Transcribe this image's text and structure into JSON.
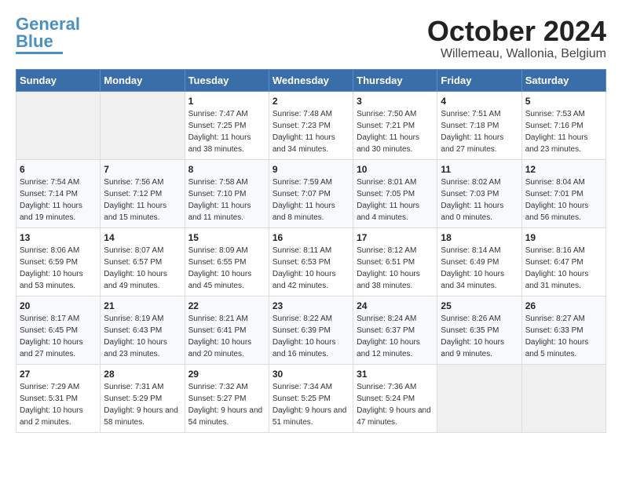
{
  "header": {
    "logo_general": "General",
    "logo_blue": "Blue",
    "month_title": "October 2024",
    "subtitle": "Willemeau, Wallonia, Belgium"
  },
  "days_of_week": [
    "Sunday",
    "Monday",
    "Tuesday",
    "Wednesday",
    "Thursday",
    "Friday",
    "Saturday"
  ],
  "weeks": [
    [
      {
        "day": "",
        "sunrise": "",
        "sunset": "",
        "daylight": ""
      },
      {
        "day": "",
        "sunrise": "",
        "sunset": "",
        "daylight": ""
      },
      {
        "day": "1",
        "sunrise": "Sunrise: 7:47 AM",
        "sunset": "Sunset: 7:25 PM",
        "daylight": "Daylight: 11 hours and 38 minutes."
      },
      {
        "day": "2",
        "sunrise": "Sunrise: 7:48 AM",
        "sunset": "Sunset: 7:23 PM",
        "daylight": "Daylight: 11 hours and 34 minutes."
      },
      {
        "day": "3",
        "sunrise": "Sunrise: 7:50 AM",
        "sunset": "Sunset: 7:21 PM",
        "daylight": "Daylight: 11 hours and 30 minutes."
      },
      {
        "day": "4",
        "sunrise": "Sunrise: 7:51 AM",
        "sunset": "Sunset: 7:18 PM",
        "daylight": "Daylight: 11 hours and 27 minutes."
      },
      {
        "day": "5",
        "sunrise": "Sunrise: 7:53 AM",
        "sunset": "Sunset: 7:16 PM",
        "daylight": "Daylight: 11 hours and 23 minutes."
      }
    ],
    [
      {
        "day": "6",
        "sunrise": "Sunrise: 7:54 AM",
        "sunset": "Sunset: 7:14 PM",
        "daylight": "Daylight: 11 hours and 19 minutes."
      },
      {
        "day": "7",
        "sunrise": "Sunrise: 7:56 AM",
        "sunset": "Sunset: 7:12 PM",
        "daylight": "Daylight: 11 hours and 15 minutes."
      },
      {
        "day": "8",
        "sunrise": "Sunrise: 7:58 AM",
        "sunset": "Sunset: 7:10 PM",
        "daylight": "Daylight: 11 hours and 11 minutes."
      },
      {
        "day": "9",
        "sunrise": "Sunrise: 7:59 AM",
        "sunset": "Sunset: 7:07 PM",
        "daylight": "Daylight: 11 hours and 8 minutes."
      },
      {
        "day": "10",
        "sunrise": "Sunrise: 8:01 AM",
        "sunset": "Sunset: 7:05 PM",
        "daylight": "Daylight: 11 hours and 4 minutes."
      },
      {
        "day": "11",
        "sunrise": "Sunrise: 8:02 AM",
        "sunset": "Sunset: 7:03 PM",
        "daylight": "Daylight: 11 hours and 0 minutes."
      },
      {
        "day": "12",
        "sunrise": "Sunrise: 8:04 AM",
        "sunset": "Sunset: 7:01 PM",
        "daylight": "Daylight: 10 hours and 56 minutes."
      }
    ],
    [
      {
        "day": "13",
        "sunrise": "Sunrise: 8:06 AM",
        "sunset": "Sunset: 6:59 PM",
        "daylight": "Daylight: 10 hours and 53 minutes."
      },
      {
        "day": "14",
        "sunrise": "Sunrise: 8:07 AM",
        "sunset": "Sunset: 6:57 PM",
        "daylight": "Daylight: 10 hours and 49 minutes."
      },
      {
        "day": "15",
        "sunrise": "Sunrise: 8:09 AM",
        "sunset": "Sunset: 6:55 PM",
        "daylight": "Daylight: 10 hours and 45 minutes."
      },
      {
        "day": "16",
        "sunrise": "Sunrise: 8:11 AM",
        "sunset": "Sunset: 6:53 PM",
        "daylight": "Daylight: 10 hours and 42 minutes."
      },
      {
        "day": "17",
        "sunrise": "Sunrise: 8:12 AM",
        "sunset": "Sunset: 6:51 PM",
        "daylight": "Daylight: 10 hours and 38 minutes."
      },
      {
        "day": "18",
        "sunrise": "Sunrise: 8:14 AM",
        "sunset": "Sunset: 6:49 PM",
        "daylight": "Daylight: 10 hours and 34 minutes."
      },
      {
        "day": "19",
        "sunrise": "Sunrise: 8:16 AM",
        "sunset": "Sunset: 6:47 PM",
        "daylight": "Daylight: 10 hours and 31 minutes."
      }
    ],
    [
      {
        "day": "20",
        "sunrise": "Sunrise: 8:17 AM",
        "sunset": "Sunset: 6:45 PM",
        "daylight": "Daylight: 10 hours and 27 minutes."
      },
      {
        "day": "21",
        "sunrise": "Sunrise: 8:19 AM",
        "sunset": "Sunset: 6:43 PM",
        "daylight": "Daylight: 10 hours and 23 minutes."
      },
      {
        "day": "22",
        "sunrise": "Sunrise: 8:21 AM",
        "sunset": "Sunset: 6:41 PM",
        "daylight": "Daylight: 10 hours and 20 minutes."
      },
      {
        "day": "23",
        "sunrise": "Sunrise: 8:22 AM",
        "sunset": "Sunset: 6:39 PM",
        "daylight": "Daylight: 10 hours and 16 minutes."
      },
      {
        "day": "24",
        "sunrise": "Sunrise: 8:24 AM",
        "sunset": "Sunset: 6:37 PM",
        "daylight": "Daylight: 10 hours and 12 minutes."
      },
      {
        "day": "25",
        "sunrise": "Sunrise: 8:26 AM",
        "sunset": "Sunset: 6:35 PM",
        "daylight": "Daylight: 10 hours and 9 minutes."
      },
      {
        "day": "26",
        "sunrise": "Sunrise: 8:27 AM",
        "sunset": "Sunset: 6:33 PM",
        "daylight": "Daylight: 10 hours and 5 minutes."
      }
    ],
    [
      {
        "day": "27",
        "sunrise": "Sunrise: 7:29 AM",
        "sunset": "Sunset: 5:31 PM",
        "daylight": "Daylight: 10 hours and 2 minutes."
      },
      {
        "day": "28",
        "sunrise": "Sunrise: 7:31 AM",
        "sunset": "Sunset: 5:29 PM",
        "daylight": "Daylight: 9 hours and 58 minutes."
      },
      {
        "day": "29",
        "sunrise": "Sunrise: 7:32 AM",
        "sunset": "Sunset: 5:27 PM",
        "daylight": "Daylight: 9 hours and 54 minutes."
      },
      {
        "day": "30",
        "sunrise": "Sunrise: 7:34 AM",
        "sunset": "Sunset: 5:25 PM",
        "daylight": "Daylight: 9 hours and 51 minutes."
      },
      {
        "day": "31",
        "sunrise": "Sunrise: 7:36 AM",
        "sunset": "Sunset: 5:24 PM",
        "daylight": "Daylight: 9 hours and 47 minutes."
      },
      {
        "day": "",
        "sunrise": "",
        "sunset": "",
        "daylight": ""
      },
      {
        "day": "",
        "sunrise": "",
        "sunset": "",
        "daylight": ""
      }
    ]
  ]
}
